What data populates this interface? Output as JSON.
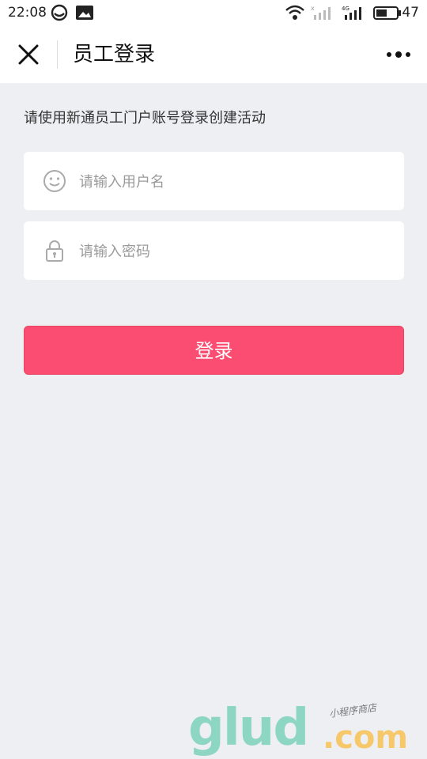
{
  "status_bar": {
    "time": "22:08",
    "battery_level": "47"
  },
  "nav": {
    "title": "员工登录"
  },
  "form": {
    "hint": "请使用新通员工门户账号登录创建活动",
    "username_placeholder": "请输入用户名",
    "password_placeholder": "请输入密码",
    "login_label": "登录"
  },
  "watermark": {
    "main": "glud",
    "domain": ".com",
    "tagline": "小程序商店"
  },
  "colors": {
    "accent": "#fa4d71",
    "background": "#eeeff3"
  },
  "icons": [
    "close-icon",
    "more-icon",
    "smiley-icon",
    "lock-icon",
    "wifi-icon",
    "signal-icon",
    "battery-icon"
  ]
}
